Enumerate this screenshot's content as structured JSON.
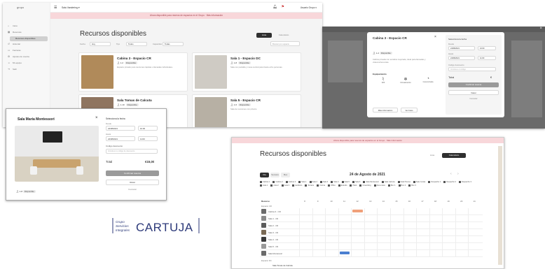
{
  "app": {
    "logo_text": "grupo",
    "workspace": "Sala Vandering ▾",
    "user": "Usuario Grupo ▾",
    "banner": "Ahora disponible para reserva de espacios en el Grupo · Más información"
  },
  "sidebar": {
    "items": [
      {
        "label": "Inicio",
        "icon": "home-icon"
      },
      {
        "label": "Reservas",
        "icon": "calendar-icon"
      },
      {
        "label": "Recursos disponibles",
        "icon": "grid-icon",
        "active": true
      },
      {
        "label": "Historial",
        "icon": "history-icon"
      },
      {
        "label": "Facturas",
        "icon": "invoice-icon"
      },
      {
        "label": "Ajustes de cuenta",
        "icon": "gear-icon"
      },
      {
        "label": "Mi equipo",
        "icon": "users-icon"
      },
      {
        "label": "Salir",
        "icon": "logout-icon"
      }
    ]
  },
  "list_view": {
    "title": "Recursos disponibles",
    "view_list": "Lista",
    "view_calendar": "Calendario",
    "filters": [
      {
        "label": "Fecha",
        "value": "Hoy"
      },
      {
        "label": "Tipo",
        "value": "Todos"
      },
      {
        "label": "Capacidad",
        "value": "Todas"
      }
    ],
    "search_placeholder": "Buscar por espacio",
    "cards": [
      {
        "title": "Cabina 3 - Espacio CR",
        "capacity": "1-2",
        "tag": "Disponible",
        "desc": "Espacio privado para reuniones rápidas o llamadas individuales.",
        "photo": "#b08a5a"
      },
      {
        "title": "Sala 1 - Espacio DC",
        "capacity": "1-8",
        "tag": "Disponible",
        "desc": "Sala con pantalla y mesa central para hasta ocho personas.",
        "photo": "#cfcbc4"
      },
      {
        "title": "Sala Tomas de Calcuta",
        "capacity": "1-10",
        "tag": "Disponible",
        "desc": "Sala amplia con iluminación natural.",
        "photo": "#8f7560"
      },
      {
        "title": "Sala 5 - Espacio CR",
        "capacity": "1-6",
        "tag": "Disponible",
        "desc": "Sala de reuniones con pizarra.",
        "photo": "#b7b0a4"
      }
    ]
  },
  "modal": {
    "title": "Cabina 3 - Espacio CR",
    "capacity": "1-2",
    "tag": "Disponible",
    "desc": "Cabina privada con acústica mejorada, ideal para llamadas y videoconferencias.",
    "amenities_title": "Equipamiento",
    "amenities": [
      "Wifi",
      "Climatización",
      "Insonorizada"
    ],
    "btn_more": "Más información",
    "btn_photos": "Ver fotos",
    "side_title": "Selecciona la fecha",
    "from_label": "Desde",
    "from_date": "24/08/2021",
    "from_time": "10:00",
    "to_label": "Hasta",
    "to_date": "24/08/2021",
    "to_time": "11:00",
    "discount_label": "Código descuento",
    "discount_placeholder": "Introduce el código",
    "total_label": "Total",
    "total_value": "€",
    "confirm": "Confirmar reserva",
    "back": "Volver",
    "cancel": "Cancelar"
  },
  "booking": {
    "title": "Sala Maria Montessori",
    "tag": "Disponible",
    "capacity": "1-8",
    "side_title": "Selecciona la fecha",
    "from_label": "Desde",
    "from_date": "24/08/2021",
    "from_time": "10:00",
    "to_label": "Hasta",
    "to_date": "24/08/2021",
    "to_time": "11:00",
    "discount_label": "Código descuento",
    "discount_placeholder": "Introduce tu código de descuento",
    "total_label": "Total",
    "total_value": "€15,00",
    "confirm": "Confirmar reserva",
    "back": "Volver",
    "cancel": "Cancelar"
  },
  "calendar": {
    "title": "Recursos disponibles",
    "view_list": "Lista",
    "view_calendar": "Calendario",
    "date_label": "24 de Agosto de 2021",
    "tabs": [
      "Día",
      "Semana",
      "Mes"
    ],
    "active_tab": "Día",
    "legend": [
      "Cabina 1",
      "Cabina 2",
      "Cabina 3",
      "Sala 1",
      "Sala 2",
      "Sala 3",
      "Sala 4",
      "Sala 5",
      "Sala 6",
      "Sala Montessori",
      "Sala Calcuta",
      "Sala Prensa",
      "Sala Juntas",
      "Despacho 1",
      "Despacho 2",
      "Despacho 3",
      "Aula 1",
      "Aula 2",
      "Aula 3",
      "Auditorio",
      "Terraza",
      "Cocina",
      "Office",
      "Estudio",
      "Plató",
      "Coworking",
      "Zona relax",
      "Box 1",
      "Box 2",
      "Box 3"
    ],
    "resource_header": "Recurso",
    "hours": [
      "8",
      "9",
      "10",
      "11",
      "12",
      "13",
      "14",
      "15",
      "16",
      "17",
      "18",
      "19",
      "20",
      "21"
    ],
    "group_1": "Espacio CR",
    "group_2": "Espacio DC",
    "rows": [
      "Cabina 3 - CR",
      "Sala 1 - CR",
      "Sala 2 - CR",
      "Sala 3 - CR",
      "Sala 4 - CR",
      "Sala 5 - CR",
      "Sala Montessori"
    ],
    "row_colors": [
      "#6b6b6b",
      "#8a8a8a",
      "#5a5a5a",
      "#7a6a55",
      "#3a3a3a",
      "#999999",
      "#6a6a6a"
    ],
    "events": [
      {
        "row": 0,
        "start": 12,
        "color": "#f0a07a"
      },
      {
        "row": 6,
        "start": 11,
        "color": "#4a7fd0"
      }
    ],
    "footer_group": "Espacio DC",
    "footer_row": "Sala Tomas de Calcuta"
  },
  "logo": {
    "small_lines": [
      "Grupo",
      "Servicios",
      "Integrales"
    ],
    "word": "CARTUJA",
    "brand_color": "#2d3a7a"
  }
}
